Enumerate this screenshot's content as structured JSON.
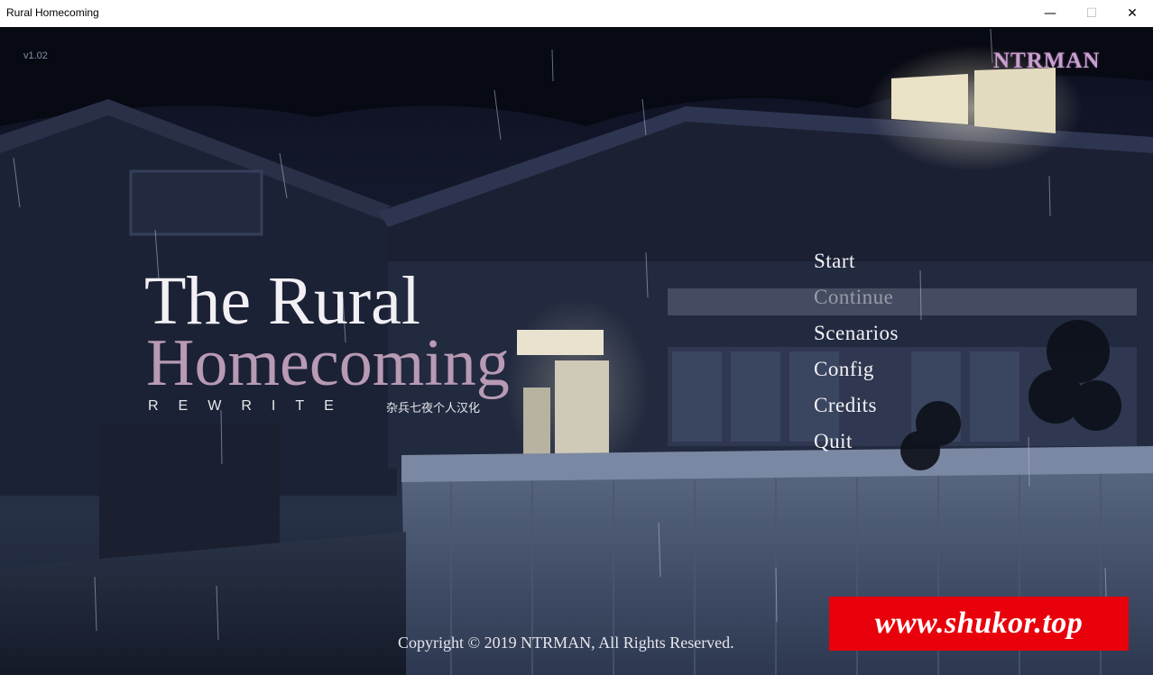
{
  "window": {
    "title": "Rural Homecoming",
    "minimize_glyph": "—",
    "maximize_glyph": "☐",
    "close_glyph": "✕"
  },
  "game": {
    "version": "v1.02",
    "brand": "NTRMAN",
    "title_line1": "The Rural",
    "title_line2": "Homecoming",
    "rewrite": "REWRITE",
    "subtitle_cn": "杂兵七夜个人汉化",
    "menu": [
      "Start",
      "Continue",
      "Scenarios",
      "Config",
      "Credits",
      "Quit"
    ],
    "menu_disabled": [
      "Continue"
    ],
    "copyright": "Copyright © 2019 NTRMAN, All Rights Reserved."
  },
  "overlay": {
    "watermark": "www.shukor.top",
    "watermark_color": "#e8000b"
  },
  "colors": {
    "title_white": "#f2f0f4",
    "title_mauve": "#b89ab4",
    "brand": "#c9a0cf"
  }
}
